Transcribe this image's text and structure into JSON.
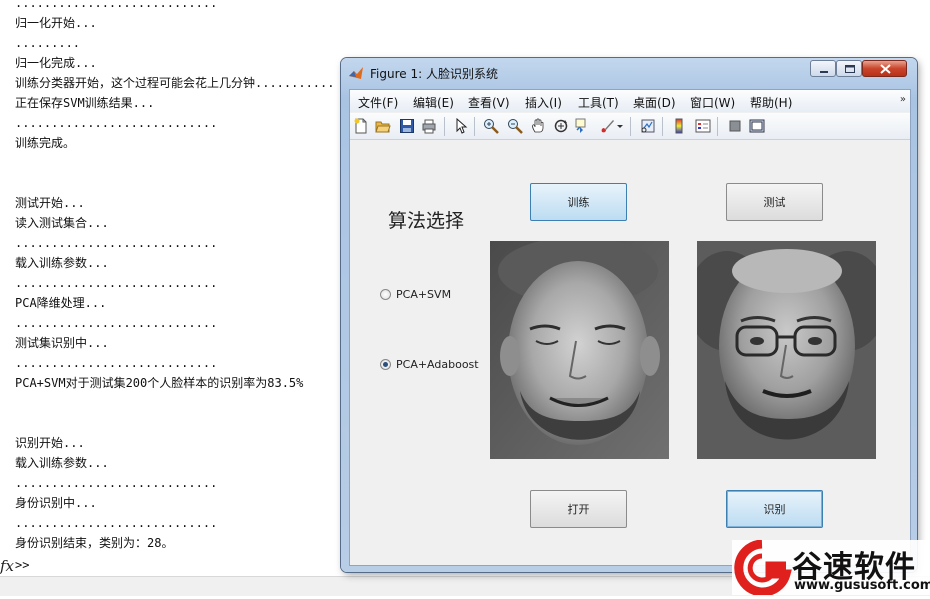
{
  "console": {
    "lines": [
      "............................",
      "归一化开始...",
      ".........",
      "归一化完成...",
      "训练分类器开始，这个过程可能会花上几分钟...........",
      "正在保存SVM训练结果...",
      "............................",
      "训练完成。",
      "",
      "",
      "测试开始...",
      "读入测试集合...",
      "............................",
      "载入训练参数...",
      "............................",
      "PCA降维处理...",
      "............................",
      "测试集识别中...",
      "............................",
      "PCA+SVM对于测试集200个人脸样本的识别率为83.5%",
      "",
      "",
      "识别开始...",
      "载入训练参数...",
      "............................",
      "身份识别中...",
      "............................",
      "身份识别结束，类别为：28。"
    ],
    "fx_label": "fx",
    "prompt": ">>"
  },
  "figure": {
    "title": "Figure 1: 人脸识别系统",
    "menu": [
      "文件(F)",
      "编辑(E)",
      "查看(V)",
      "插入(I)",
      "工具(T)",
      "桌面(D)",
      "窗口(W)",
      "帮助(H)"
    ],
    "menu_overflow": "»",
    "toolbar_icons": [
      "new-figure-icon",
      "open-file-icon",
      "save-icon",
      "print-icon",
      "pointer-icon",
      "zoom-in-icon",
      "zoom-out-icon",
      "pan-icon",
      "rotate-3d-icon",
      "data-cursor-icon",
      "brush-icon",
      "brush-dropdown-icon",
      "link-plot-icon",
      "colorbar-icon",
      "legend-icon",
      "hide-plot-tools-icon",
      "show-plot-tools-icon"
    ],
    "buttons": {
      "train": "训练",
      "test": "测试",
      "open": "打开",
      "recognize": "识别"
    },
    "algo_title": "算法选择",
    "radios": [
      {
        "label": "PCA+SVM",
        "selected": false
      },
      {
        "label": "PCA+Adaboost",
        "selected": true
      }
    ],
    "images": [
      "face-image-query",
      "face-image-match"
    ]
  },
  "watermark": {
    "name": "谷速软件",
    "url": "www.gususoft.com",
    "color": "#e0201c"
  }
}
